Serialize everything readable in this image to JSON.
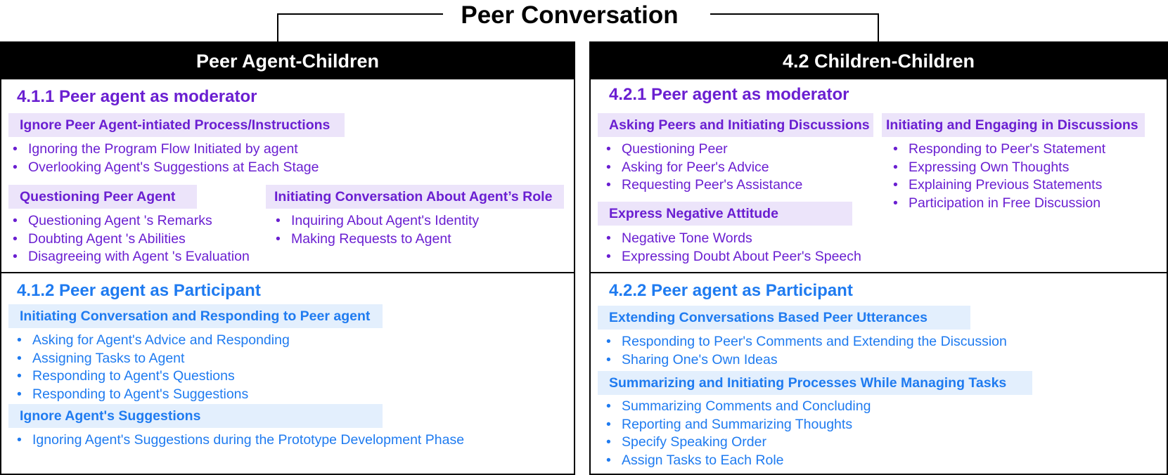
{
  "title": "Peer Conversation",
  "left": {
    "header": "Peer Agent-Children",
    "moderator": {
      "title": "4.1.1 Peer agent as moderator",
      "groups": [
        {
          "label": "Ignore Peer Agent-intiated Process/Instructions",
          "items": [
            "Ignoring the Program Flow Initiated by agent",
            "Overlooking Agent's Suggestions at Each Stage"
          ]
        },
        {
          "label": "Questioning Peer Agent",
          "items": [
            "Questioning  Agent 's Remarks",
            "Doubting  Agent 's Abilities",
            "Disagreeing with Agent 's Evaluation"
          ]
        },
        {
          "label": "Initiating Conversation About Agent’s Role",
          "items": [
            "Inquiring About Agent's Identity",
            "Making Requests to Agent"
          ]
        }
      ]
    },
    "participant": {
      "title": "4.1.2 Peer agent as Participant",
      "groups": [
        {
          "label": "Initiating Conversation and Responding to Peer agent",
          "items": [
            "Asking for Agent's Advice and Responding",
            "Assigning Tasks to Agent",
            "Responding to Agent's Questions",
            "Responding to Agent's Suggestions"
          ]
        },
        {
          "label": "Ignore Agent's Suggestions",
          "items": [
            "Ignoring Agent's Suggestions during the Prototype Development Phase"
          ]
        }
      ]
    }
  },
  "right": {
    "header": "4.2 Children-Children",
    "moderator": {
      "title": "4.2.1 Peer agent as moderator",
      "groups": [
        {
          "label": "Asking Peers and Initiating Discussions",
          "items": [
            "Questioning Peer",
            "Asking for Peer's Advice",
            "Requesting Peer's Assistance"
          ]
        },
        {
          "label": "Initiating and Engaging in Discussions",
          "items": [
            "Responding to Peer's Statement",
            "Expressing Own Thoughts",
            "Explaining Previous Statements",
            "Participation in Free Discussion"
          ]
        },
        {
          "label": "Express Negative Attitude",
          "items": [
            "Negative Tone Words",
            "Expressing Doubt About Peer's Speech"
          ]
        }
      ]
    },
    "participant": {
      "title": "4.2.2 Peer agent as Participant",
      "groups": [
        {
          "label": "Extending Conversations Based Peer Utterances",
          "items": [
            "Responding to Peer's Comments and Extending the Discussion",
            "Sharing One's Own Ideas"
          ]
        },
        {
          "label": "Summarizing and Initiating Processes  While Managing Tasks",
          "items": [
            "Summarizing Comments and Concluding",
            "Reporting and Summarizing Thoughts",
            "Specify Speaking Order",
            "Assign Tasks to Each Role"
          ]
        }
      ]
    }
  },
  "colors": {
    "purple": "#6a1fd1",
    "purple_bg": "#ece4fa",
    "blue": "#1f7bf0",
    "blue_bg": "#e3effd"
  }
}
